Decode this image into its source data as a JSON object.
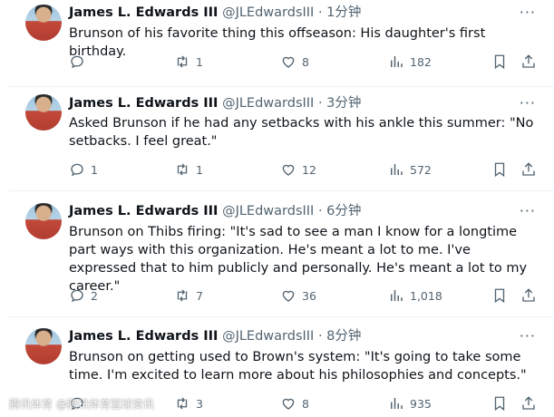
{
  "author": {
    "name": "James L. Edwards III",
    "handle": "@JLEdwardsIII"
  },
  "tweets": [
    {
      "time": "1分钟",
      "text": "Brunson of his favorite thing this offseason: His daughter's first birthday.",
      "replies": "",
      "retweets": "1",
      "likes": "8",
      "views": "182"
    },
    {
      "time": "3分钟",
      "text": "Asked Brunson if he had any setbacks with his ankle this summer: \"No setbacks. I feel great.\"",
      "replies": "1",
      "retweets": "1",
      "likes": "12",
      "views": "572"
    },
    {
      "time": "6分钟",
      "text": "Brunson on Thibs firing: \"It's sad to see a man I know for a longtime part ways with this organization. He's meant a lot to me. I've expressed that to him publicly and personally. He's meant a lot to my career.\"",
      "replies": "2",
      "retweets": "7",
      "likes": "36",
      "views": "1,018"
    },
    {
      "time": "8分钟",
      "text": "Brunson on getting used to Brown's system: \"It's going to take some time. I'm excited to learn more about his philosophies and concepts.\"",
      "replies": "",
      "retweets": "3",
      "likes": "8",
      "views": "935"
    }
  ],
  "separator": " · ",
  "more_label": "···",
  "watermark": "腾讯体育 @腾讯体育篮球资讯",
  "colors": {
    "text": "#0f1419",
    "secondary": "#536471",
    "divider": "#eff3f4"
  }
}
